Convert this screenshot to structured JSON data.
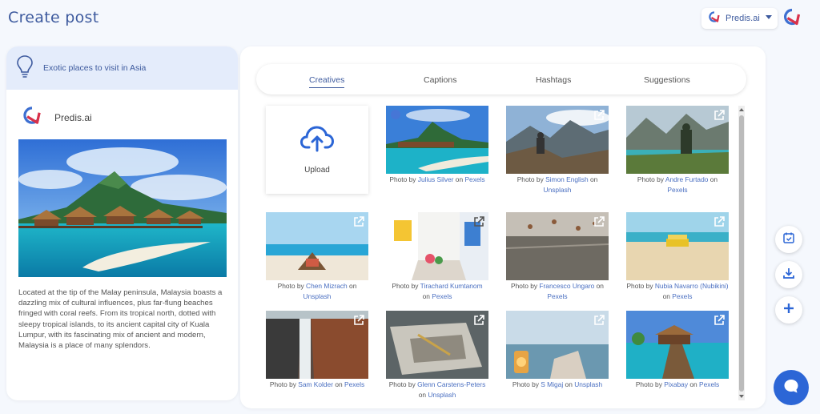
{
  "header": {
    "title": "Create post"
  },
  "brand_selector": {
    "value": "Predis.ai",
    "icon": "predis-logo-icon",
    "caret": "chevron-down-icon"
  },
  "left_panel": {
    "topic_icon": "lightbulb-icon",
    "topic": "Exotic places to visit in Asia",
    "brand_name": "Predis.ai",
    "caption": "Located at the tip of the Malay peninsula, Malaysia boasts a dazzling mix of cultural influences, plus far-flung beaches fringed with coral reefs. From its tropical north, dotted with sleepy tropical islands, to its ancient capital city of Kuala Lumpur, with its fascinating mix of ancient and modern, Malaysia is a place of many splendors."
  },
  "tabs": [
    {
      "label": "Creatives",
      "active": true
    },
    {
      "label": "Captions",
      "active": false
    },
    {
      "label": "Hashtags",
      "active": false
    },
    {
      "label": "Suggestions",
      "active": false
    }
  ],
  "upload": {
    "label": "Upload",
    "icon": "cloud-upload-icon"
  },
  "photos": [
    {
      "prefix": "Photo by",
      "author": "Julius Silver",
      "on": "on",
      "source": "Pexels"
    },
    {
      "prefix": "Photo by",
      "author": "Simon English",
      "on": "on",
      "source": "Unsplash"
    },
    {
      "prefix": "Photo by",
      "author": "Andre Furtado",
      "on": "on",
      "source": "Pexels"
    },
    {
      "prefix": "Photo by",
      "author": "Chen Mizrach",
      "on": "on",
      "source": "Unsplash"
    },
    {
      "prefix": "Photo by",
      "author": "Tirachard Kumtanom",
      "on": "on",
      "source": "Pexels"
    },
    {
      "prefix": "Photo by",
      "author": "Francesco Ungaro",
      "on": "on",
      "source": "Pexels"
    },
    {
      "prefix": "Photo by",
      "author": "Nubia Navarro (Nubikini)",
      "on": "on",
      "source": "Pexels"
    },
    {
      "prefix": "Photo by",
      "author": "Sam Kolder",
      "on": "on",
      "source": "Pexels"
    },
    {
      "prefix": "Photo by",
      "author": "Glenn Carstens-Peters",
      "on": "on",
      "source": "Unsplash"
    },
    {
      "prefix": "Photo by",
      "author": "S Migaj",
      "on": "on",
      "source": "Unsplash"
    },
    {
      "prefix": "Photo by",
      "author": "Pixabay",
      "on": "on",
      "source": "Pexels"
    }
  ],
  "side_actions": [
    "calendar-check-icon",
    "download-icon",
    "plus-icon"
  ],
  "chat": {
    "icon": "chat-bubble-icon"
  },
  "colors": {
    "accent": "#3d5a9e",
    "link": "#4a6fc1",
    "chat": "#2c66d6",
    "topic_bg": "#e4ecfb"
  }
}
